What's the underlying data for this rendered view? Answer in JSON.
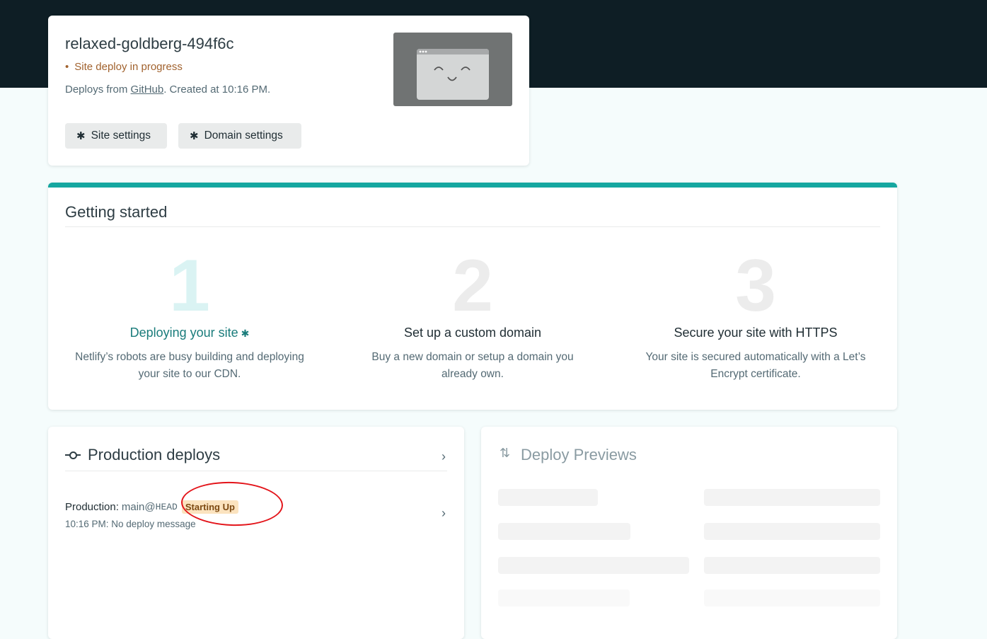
{
  "site": {
    "name": "relaxed-goldberg-494f6c",
    "status_bullet": "•",
    "status": "Site deploy in progress",
    "meta_prefix": "Deploys from",
    "meta_link": "GitHub",
    "meta_suffix": ". Created at 10:16 PM.",
    "buttons": {
      "site_settings": "Site settings",
      "domain_settings": "Domain settings"
    }
  },
  "getting_started": {
    "title": "Getting started",
    "steps": [
      {
        "number": "1",
        "title": "Deploying your site",
        "description": "Netlify’s robots are busy building and deploying your site to our CDN.",
        "active": true
      },
      {
        "number": "2",
        "title": "Set up a custom domain",
        "description": "Buy a new domain or setup a domain you already own."
      },
      {
        "number": "3",
        "title": "Secure your site with HTTPS",
        "description": "Your site is secured automatically with a Let’s Encrypt certificate."
      }
    ]
  },
  "production_deploys": {
    "title": "Production deploys",
    "label": "Production:",
    "branch": "main@",
    "ref": "HEAD",
    "badge": "Starting Up",
    "message": "10:16 PM: No deploy message"
  },
  "deploy_previews": {
    "title": "Deploy Previews"
  },
  "colors": {
    "accent": "#15a7a0",
    "badge_bg": "#fbe3bf",
    "status": "#a1622e",
    "annotation": "#e3141a"
  }
}
